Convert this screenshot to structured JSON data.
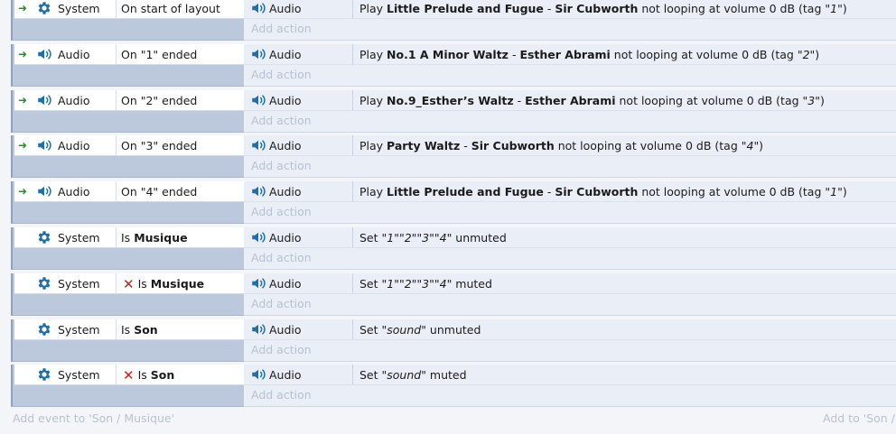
{
  "labels": {
    "add_action": "Add action",
    "add_event": "Add event to 'Son / Musique'",
    "add_to": "Add to 'Son / "
  },
  "colors": {
    "trigger_arrow": "#2f8a2f",
    "invert_x": "#d31b1b",
    "object_icon": "#1f6fa8"
  },
  "events": [
    {
      "trigger": true,
      "object": "System",
      "object_icon": "gear-icon",
      "condition": [
        {
          "t": "On start of layout"
        }
      ],
      "action_object": "Audio",
      "action_icon": "speaker-icon",
      "action": [
        {
          "t": "Play "
        },
        {
          "t": "Little Prelude and Fugue",
          "b": true
        },
        {
          "t": " - "
        },
        {
          "t": "Sir Cubworth",
          "b": true
        },
        {
          "t": " not looping at volume 0 dB (tag \""
        },
        {
          "t": "1",
          "i": true
        },
        {
          "t": "\")"
        }
      ]
    },
    {
      "trigger": true,
      "object": "Audio",
      "object_icon": "speaker-icon",
      "condition": [
        {
          "t": "On \"1\" ended"
        }
      ],
      "action_object": "Audio",
      "action_icon": "speaker-icon",
      "action": [
        {
          "t": "Play "
        },
        {
          "t": "No.1 A Minor Waltz",
          "b": true
        },
        {
          "t": " - "
        },
        {
          "t": "Esther Abrami",
          "b": true
        },
        {
          "t": " not looping at volume 0 dB (tag \""
        },
        {
          "t": "2",
          "i": true
        },
        {
          "t": "\")"
        }
      ]
    },
    {
      "trigger": true,
      "object": "Audio",
      "object_icon": "speaker-icon",
      "condition": [
        {
          "t": "On \"2\" ended"
        }
      ],
      "action_object": "Audio",
      "action_icon": "speaker-icon",
      "action": [
        {
          "t": "Play "
        },
        {
          "t": "No.9_Esther’s Waltz",
          "b": true
        },
        {
          "t": " - "
        },
        {
          "t": "Esther Abrami",
          "b": true
        },
        {
          "t": " not looping at volume 0 dB (tag \""
        },
        {
          "t": "3",
          "i": true
        },
        {
          "t": "\")"
        }
      ]
    },
    {
      "trigger": true,
      "object": "Audio",
      "object_icon": "speaker-icon",
      "condition": [
        {
          "t": "On \"3\" ended"
        }
      ],
      "action_object": "Audio",
      "action_icon": "speaker-icon",
      "action": [
        {
          "t": "Play "
        },
        {
          "t": "Party Waltz",
          "b": true
        },
        {
          "t": " - "
        },
        {
          "t": "Sir Cubworth",
          "b": true
        },
        {
          "t": " not looping at volume 0 dB (tag \""
        },
        {
          "t": "4",
          "i": true
        },
        {
          "t": "\")"
        }
      ]
    },
    {
      "trigger": true,
      "object": "Audio",
      "object_icon": "speaker-icon",
      "condition": [
        {
          "t": "On \"4\" ended"
        }
      ],
      "action_object": "Audio",
      "action_icon": "speaker-icon",
      "action": [
        {
          "t": "Play "
        },
        {
          "t": "Little Prelude and Fugue",
          "b": true
        },
        {
          "t": " - "
        },
        {
          "t": "Sir Cubworth",
          "b": true
        },
        {
          "t": " not looping at volume 0 dB (tag \""
        },
        {
          "t": "1",
          "i": true
        },
        {
          "t": "\")"
        }
      ]
    },
    {
      "trigger": false,
      "object": "System",
      "object_icon": "gear-icon",
      "condition": [
        {
          "t": "Is "
        },
        {
          "t": "Musique",
          "b": true
        }
      ],
      "action_object": "Audio",
      "action_icon": "speaker-icon",
      "action": [
        {
          "t": "Set \""
        },
        {
          "t": "1",
          "i": true
        },
        {
          "t": "\"\""
        },
        {
          "t": "2",
          "i": true
        },
        {
          "t": "\"\""
        },
        {
          "t": "3",
          "i": true
        },
        {
          "t": "\"\""
        },
        {
          "t": "4",
          "i": true
        },
        {
          "t": "\" unmuted"
        }
      ]
    },
    {
      "trigger": false,
      "inverted": true,
      "object": "System",
      "object_icon": "gear-icon",
      "condition": [
        {
          "t": "Is "
        },
        {
          "t": "Musique",
          "b": true
        }
      ],
      "action_object": "Audio",
      "action_icon": "speaker-icon",
      "action": [
        {
          "t": "Set \""
        },
        {
          "t": "1",
          "i": true
        },
        {
          "t": "\"\""
        },
        {
          "t": "2",
          "i": true
        },
        {
          "t": "\"\""
        },
        {
          "t": "3",
          "i": true
        },
        {
          "t": "\"\""
        },
        {
          "t": "4",
          "i": true
        },
        {
          "t": "\" muted"
        }
      ]
    },
    {
      "trigger": false,
      "object": "System",
      "object_icon": "gear-icon",
      "condition": [
        {
          "t": "Is "
        },
        {
          "t": "Son",
          "b": true
        }
      ],
      "action_object": "Audio",
      "action_icon": "speaker-icon",
      "action": [
        {
          "t": "Set \""
        },
        {
          "t": "sound",
          "i": true
        },
        {
          "t": "\" unmuted"
        }
      ]
    },
    {
      "trigger": false,
      "inverted": true,
      "object": "System",
      "object_icon": "gear-icon",
      "condition": [
        {
          "t": "Is "
        },
        {
          "t": "Son",
          "b": true
        }
      ],
      "action_object": "Audio",
      "action_icon": "speaker-icon",
      "action": [
        {
          "t": "Set \""
        },
        {
          "t": "sound",
          "i": true
        },
        {
          "t": "\" muted"
        }
      ]
    }
  ]
}
